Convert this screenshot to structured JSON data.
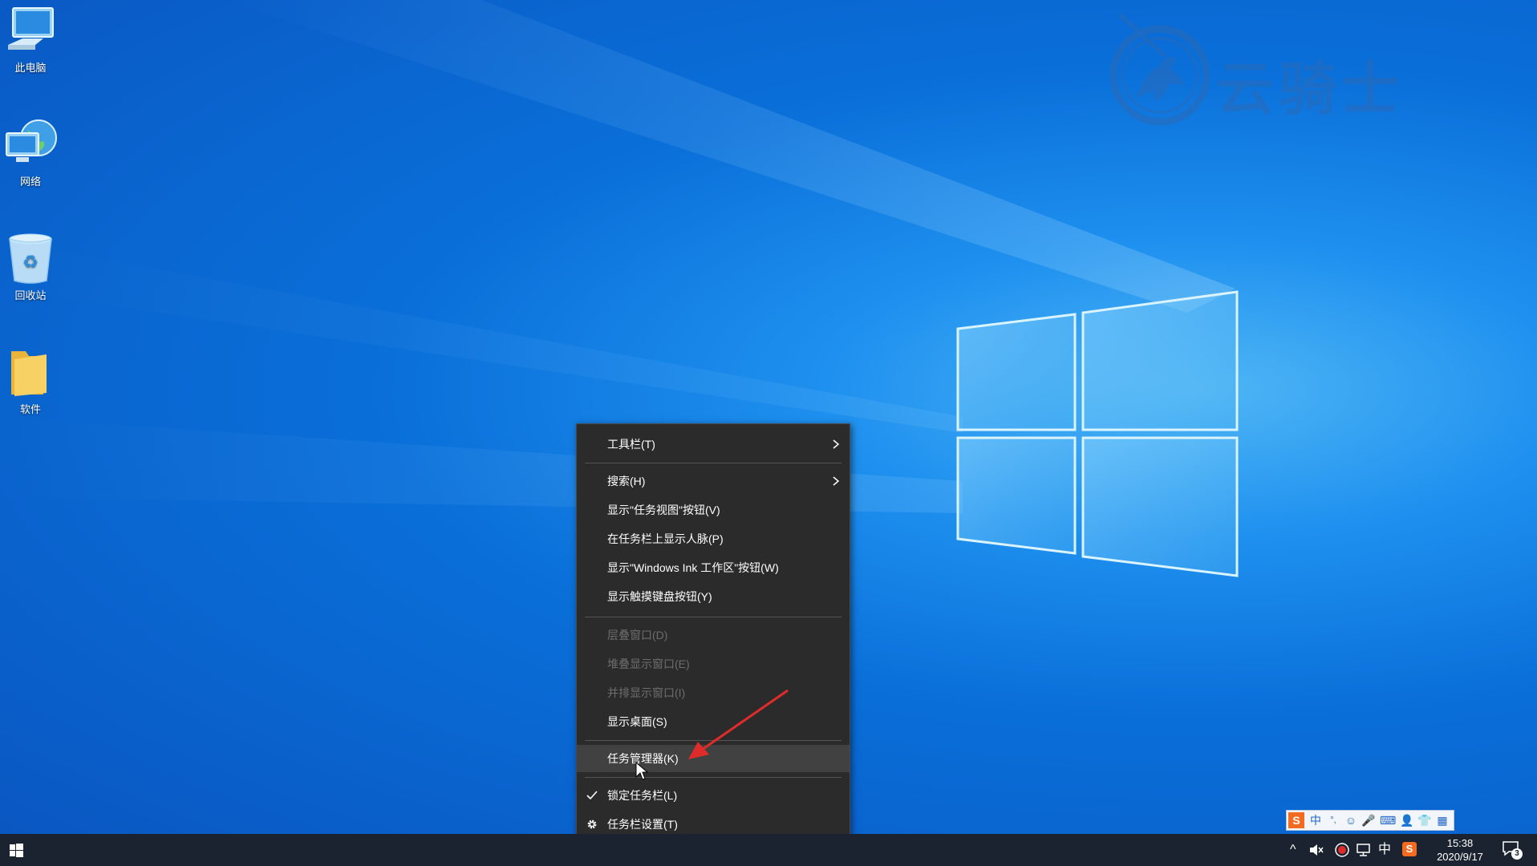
{
  "desktop": {
    "icons": [
      {
        "label": "此电脑",
        "icon": "computer-icon"
      },
      {
        "label": "网络",
        "icon": "network-icon"
      },
      {
        "label": "回收站",
        "icon": "recycle-bin-icon"
      },
      {
        "label": "软件",
        "icon": "folder-icon"
      }
    ]
  },
  "watermark": {
    "text": "云骑士",
    "icon": "knight-logo"
  },
  "context_menu": {
    "items": [
      {
        "label": "工具栏(T)",
        "submenu": true,
        "enabled": true
      },
      {
        "label": "搜索(H)",
        "submenu": true,
        "enabled": true
      },
      {
        "label": "显示\"任务视图\"按钮(V)",
        "enabled": true
      },
      {
        "label": "在任务栏上显示人脉(P)",
        "enabled": true
      },
      {
        "label": "显示\"Windows Ink 工作区\"按钮(W)",
        "enabled": true
      },
      {
        "label": "显示触摸键盘按钮(Y)",
        "enabled": true
      },
      {
        "label": "层叠窗口(D)",
        "enabled": false
      },
      {
        "label": "堆叠显示窗口(E)",
        "enabled": false
      },
      {
        "label": "并排显示窗口(I)",
        "enabled": false
      },
      {
        "label": "显示桌面(S)",
        "enabled": true
      },
      {
        "label": "任务管理器(K)",
        "enabled": true,
        "highlighted": true
      },
      {
        "label": "锁定任务栏(L)",
        "enabled": true,
        "checked": true
      },
      {
        "label": "任务栏设置(T)",
        "enabled": true,
        "icon": "gear-icon"
      }
    ]
  },
  "ime_toolbar": {
    "items": [
      "S",
      "中",
      "°,",
      "☺",
      "🎤",
      "⌨",
      "👤",
      "👕",
      "▦"
    ]
  },
  "taskbar": {
    "tray": {
      "chevron": "^",
      "volume": "volume-muted-icon",
      "record": "record-icon",
      "network": "network-icon",
      "ime_lang": "中",
      "sogou": "S"
    },
    "clock": {
      "time": "15:38",
      "date": "2020/9/17"
    },
    "notification_count": "3"
  },
  "colors": {
    "desktop_accent": "#0a6fd9",
    "menu_bg": "#2b2b2b",
    "menu_hover": "#414141",
    "taskbar": "#1b2330",
    "arrow": "#e02b2b"
  }
}
